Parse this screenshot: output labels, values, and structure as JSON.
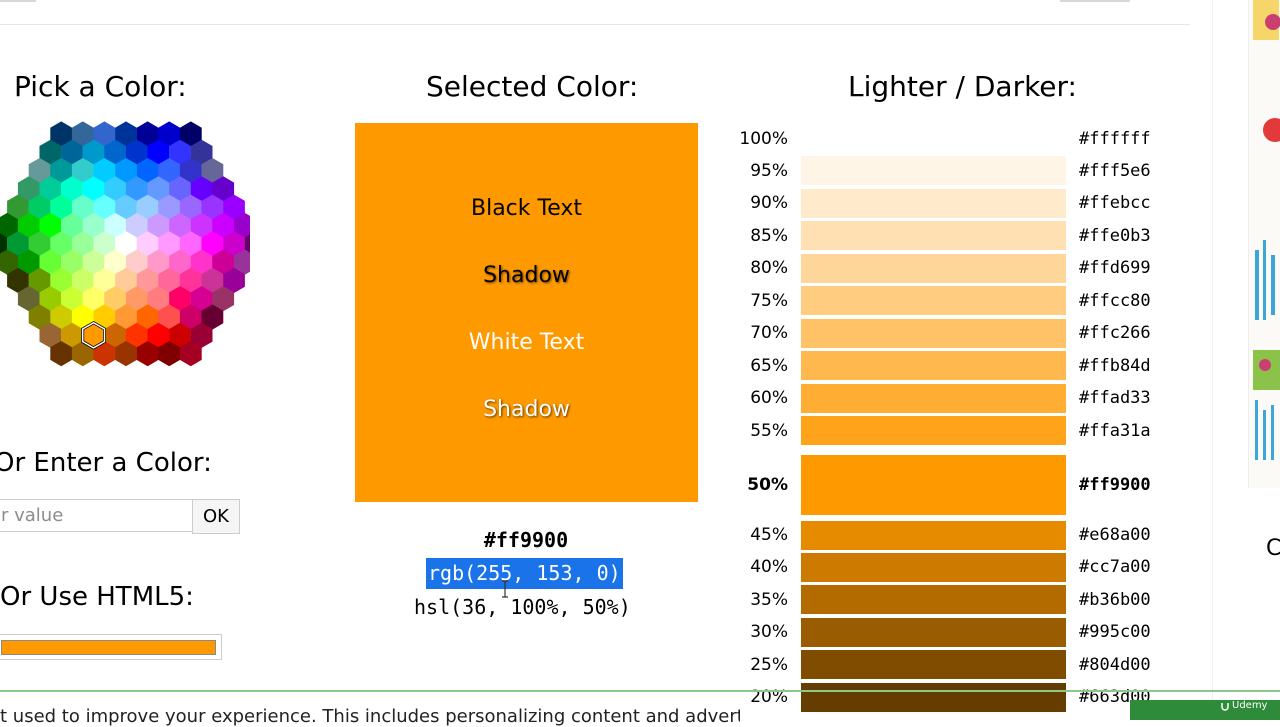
{
  "headings": {
    "pick": "Pick a Color:",
    "selected": "Selected Color:",
    "lighter_darker": "Lighter / Darker:",
    "enter": "Or Enter a Color:",
    "html5": "Or Use HTML5:"
  },
  "input": {
    "placeholder": "r value",
    "ok_label": "OK"
  },
  "selected": {
    "color": "#ff9900",
    "samples": [
      "Black Text",
      "Shadow",
      "White Text",
      "Shadow"
    ],
    "hex": "#ff9900",
    "rgb": "rgb(255, 153, 0)",
    "hsl": "hsl(36, 100%, 50%)"
  },
  "shades": [
    {
      "pct": "100%",
      "hex": "#ffffff"
    },
    {
      "pct": "95%",
      "hex": "#fff5e6"
    },
    {
      "pct": "90%",
      "hex": "#ffebcc"
    },
    {
      "pct": "85%",
      "hex": "#ffe0b3"
    },
    {
      "pct": "80%",
      "hex": "#ffd699"
    },
    {
      "pct": "75%",
      "hex": "#ffcc80"
    },
    {
      "pct": "70%",
      "hex": "#ffc266"
    },
    {
      "pct": "65%",
      "hex": "#ffb84d"
    },
    {
      "pct": "60%",
      "hex": "#ffad33"
    },
    {
      "pct": "55%",
      "hex": "#ffa31a"
    },
    {
      "pct": "50%",
      "hex": "#ff9900",
      "selected": true
    },
    {
      "pct": "45%",
      "hex": "#e68a00"
    },
    {
      "pct": "40%",
      "hex": "#cc7a00"
    },
    {
      "pct": "35%",
      "hex": "#b36b00"
    },
    {
      "pct": "30%",
      "hex": "#995c00"
    },
    {
      "pct": "25%",
      "hex": "#804d00"
    },
    {
      "pct": "20%",
      "hex": "#663d00"
    }
  ],
  "hex_palette": [
    [
      "#003366",
      "#336699",
      "#3366CC",
      "#003399",
      "#000099",
      "#0000CC",
      "#000066"
    ],
    [
      "#006666",
      "#006699",
      "#0099CC",
      "#0066CC",
      "#0033CC",
      "#0000FF",
      "#3333FF",
      "#333399"
    ],
    [
      "#669999",
      "#009999",
      "#33CCCC",
      "#00CCFF",
      "#0099FF",
      "#0066FF",
      "#3366FF",
      "#3333CC",
      "#666699"
    ],
    [
      "#339966",
      "#00CC99",
      "#00FFCC",
      "#00FFFF",
      "#33CCFF",
      "#3399FF",
      "#6699FF",
      "#6666FF",
      "#6600FF",
      "#6600CC"
    ],
    [
      "#339933",
      "#00CC66",
      "#00FF99",
      "#66FFCC",
      "#66FFFF",
      "#66CCFF",
      "#99CCFF",
      "#9999FF",
      "#9966FF",
      "#9933FF",
      "#9900FF"
    ],
    [
      "#006600",
      "#00CC00",
      "#00FF00",
      "#66FF99",
      "#99FFCC",
      "#CCFFFF",
      "#CCCCFF",
      "#CC99FF",
      "#CC66FF",
      "#CC33FF",
      "#CC00FF",
      "#9900CC"
    ],
    [
      "#003300",
      "#009933",
      "#33CC33",
      "#66FF66",
      "#99FF99",
      "#CCFFCC",
      "#FFFFFF",
      "#FFCCFF",
      "#FF99FF",
      "#FF66FF",
      "#FF00FF",
      "#CC00CC",
      "#660066"
    ],
    [
      "#336600",
      "#009900",
      "#66FF33",
      "#99FF66",
      "#CCFF99",
      "#FFFFCC",
      "#FFCCCC",
      "#FF99CC",
      "#FF66CC",
      "#FF33CC",
      "#CC0099",
      "#993399"
    ],
    [
      "#333300",
      "#669900",
      "#99FF33",
      "#CCFF66",
      "#FFFF99",
      "#FFCC99",
      "#FF9999",
      "#FF6699",
      "#FF3399",
      "#CC3399",
      "#990099"
    ],
    [
      "#666633",
      "#99CC00",
      "#CCFF33",
      "#FFFF66",
      "#FFCC66",
      "#FF9966",
      "#FF7C80",
      "#FF0066",
      "#D60093",
      "#993366"
    ],
    [
      "#808000",
      "#CCCC00",
      "#FFFF00",
      "#FFCC00",
      "#FF9933",
      "#FF6600",
      "#FF5050",
      "#CC0066",
      "#660033"
    ],
    [
      "#996633",
      "#CC9900",
      "#FF9900",
      "#CC6600",
      "#FF3300",
      "#FF0000",
      "#CC0000",
      "#990033"
    ],
    [
      "#663300",
      "#996600",
      "#CC3300",
      "#993300",
      "#990000",
      "#800000",
      "#A50021"
    ]
  ],
  "selected_hex_index": [
    11,
    2
  ],
  "side_letter": "C",
  "bottom_text": "t used to improve your experience. This includes personalizing content and advertising",
  "udemy_label": "Udemy"
}
